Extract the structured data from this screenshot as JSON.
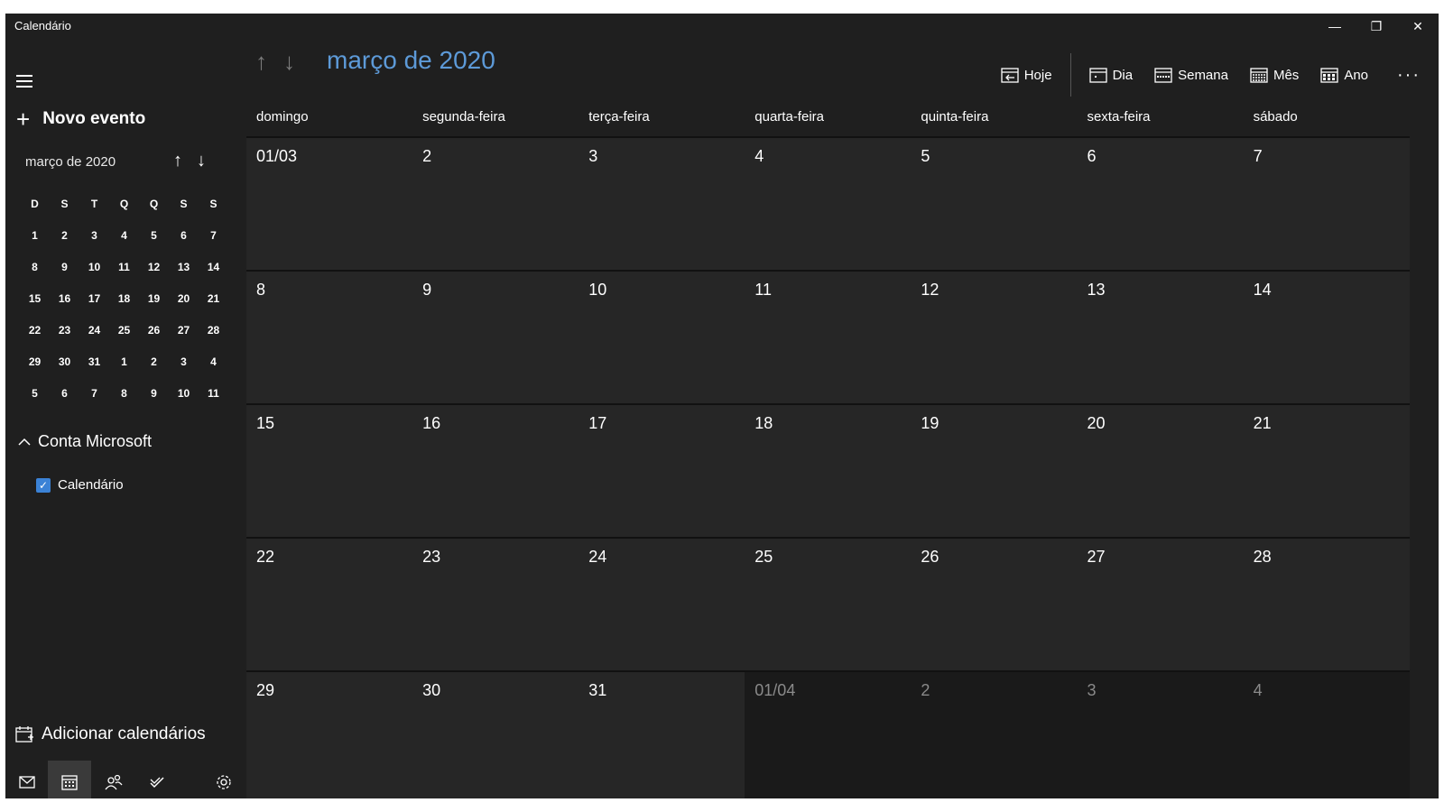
{
  "window": {
    "title": "Calendário"
  },
  "window_controls": {
    "minimize": "—",
    "restore": "❐",
    "close": "✕"
  },
  "sidebar": {
    "new_event": "Novo evento",
    "mini_calendar": {
      "title": "março de 2020",
      "dow": [
        "D",
        "S",
        "T",
        "Q",
        "Q",
        "S",
        "S"
      ],
      "weeks": [
        [
          "1",
          "2",
          "3",
          "4",
          "5",
          "6",
          "7"
        ],
        [
          "8",
          "9",
          "10",
          "11",
          "12",
          "13",
          "14"
        ],
        [
          "15",
          "16",
          "17",
          "18",
          "19",
          "20",
          "21"
        ],
        [
          "22",
          "23",
          "24",
          "25",
          "26",
          "27",
          "28"
        ],
        [
          "29",
          "30",
          "31",
          "1",
          "2",
          "3",
          "4"
        ],
        [
          "5",
          "6",
          "7",
          "8",
          "9",
          "10",
          "11"
        ]
      ]
    },
    "account": "Conta Microsoft",
    "calendar_checkbox": "Calendário",
    "add_calendars": "Adicionar calendários"
  },
  "header": {
    "month_title": "março de 2020",
    "toolbar": {
      "today": "Hoje",
      "day": "Dia",
      "week": "Semana",
      "month": "Mês",
      "year": "Ano"
    }
  },
  "month_grid": {
    "dow": [
      "domingo",
      "segunda-feira",
      "terça-feira",
      "quarta-feira",
      "quinta-feira",
      "sexta-feira",
      "sábado"
    ],
    "weeks": [
      [
        "01/03",
        "2",
        "3",
        "4",
        "5",
        "6",
        "7"
      ],
      [
        "8",
        "9",
        "10",
        "11",
        "12",
        "13",
        "14"
      ],
      [
        "15",
        "16",
        "17",
        "18",
        "19",
        "20",
        "21"
      ],
      [
        "22",
        "23",
        "24",
        "25",
        "26",
        "27",
        "28"
      ],
      [
        "29",
        "30",
        "31",
        "01/04",
        "2",
        "3",
        "4"
      ]
    ]
  },
  "colors": {
    "accent": "#5d9ad8",
    "background": "#1f1f1f",
    "cell": "#262626",
    "out_of_month": "#1a1a1a"
  },
  "icons": [
    "hamburger-icon",
    "plus-icon",
    "arrow-up-icon",
    "arrow-down-icon",
    "chevron-up-icon",
    "checkbox-icon",
    "add-calendar-icon",
    "mail-icon",
    "calendar-icon",
    "people-icon",
    "todo-icon",
    "settings-icon",
    "today-icon",
    "day-view-icon",
    "week-view-icon",
    "month-view-icon",
    "year-view-icon",
    "more-icon"
  ]
}
